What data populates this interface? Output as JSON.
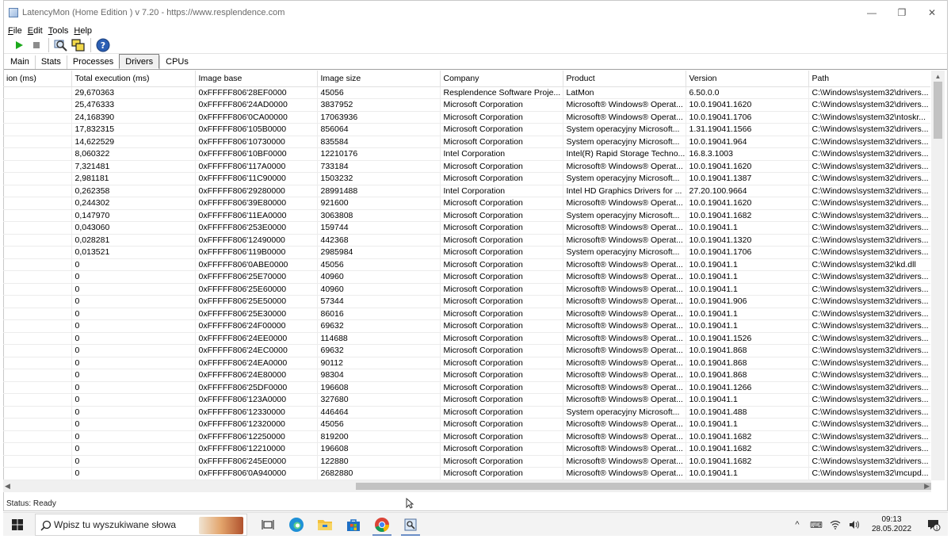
{
  "window": {
    "title": "LatencyMon  (Home Edition )  v 7.20 - https://www.resplendence.com",
    "controls": {
      "minimize": "—",
      "maximize": "❐",
      "close": "✕"
    }
  },
  "menu": [
    "File",
    "Edit",
    "Tools",
    "Help"
  ],
  "toolbar": {
    "icons": [
      "play-icon",
      "stop-icon",
      "search-icon",
      "windows-icon",
      "help-icon"
    ],
    "colors": {
      "play": "#1ca91c",
      "stop": "#8c8c8c",
      "help": "#2b5fb4"
    }
  },
  "tabs": [
    {
      "label": "Main",
      "active": false
    },
    {
      "label": "Stats",
      "active": false
    },
    {
      "label": "Processes",
      "active": false
    },
    {
      "label": "Drivers",
      "active": true
    },
    {
      "label": "CPUs",
      "active": false
    }
  ],
  "grid": {
    "columns": [
      "ion (ms)",
      "Total execution (ms)",
      "Image base",
      "Image size",
      "Company",
      "Product",
      "Version",
      "Path"
    ],
    "rows": [
      [
        "",
        "29,670363",
        "0xFFFFF806'28EF0000",
        "45056",
        "Resplendence Software Proje...",
        "LatMon",
        "6.50.0.0",
        "C:\\Windows\\system32\\drivers..."
      ],
      [
        "",
        "25,476333",
        "0xFFFFF806'24AD0000",
        "3837952",
        "Microsoft Corporation",
        "Microsoft® Windows® Operat...",
        "10.0.19041.1620",
        "C:\\Windows\\system32\\drivers..."
      ],
      [
        "",
        "24,168390",
        "0xFFFFF806'0CA00000",
        "17063936",
        "Microsoft Corporation",
        "Microsoft® Windows® Operat...",
        "10.0.19041.1706",
        "C:\\Windows\\system32\\ntoskr..."
      ],
      [
        "",
        "17,832315",
        "0xFFFFF806'105B0000",
        "856064",
        "Microsoft Corporation",
        "System operacyjny Microsoft...",
        "1.31.19041.1566",
        "C:\\Windows\\system32\\drivers..."
      ],
      [
        "",
        "14,622529",
        "0xFFFFF806'10730000",
        "835584",
        "Microsoft Corporation",
        "System operacyjny Microsoft...",
        "10.0.19041.964",
        "C:\\Windows\\system32\\drivers..."
      ],
      [
        "",
        "8,060322",
        "0xFFFFF806'10BF0000",
        "12210176",
        "Intel Corporation",
        "Intel(R) Rapid Storage Techno...",
        "16.8.3.1003",
        "C:\\Windows\\system32\\drivers..."
      ],
      [
        "",
        "7,321481",
        "0xFFFFF806'117A0000",
        "733184",
        "Microsoft Corporation",
        "Microsoft® Windows® Operat...",
        "10.0.19041.1620",
        "C:\\Windows\\system32\\drivers..."
      ],
      [
        "",
        "2,981181",
        "0xFFFFF806'11C90000",
        "1503232",
        "Microsoft Corporation",
        "System operacyjny Microsoft...",
        "10.0.19041.1387",
        "C:\\Windows\\system32\\drivers..."
      ],
      [
        "",
        "0,262358",
        "0xFFFFF806'29280000",
        "28991488",
        "Intel Corporation",
        "Intel HD Graphics Drivers for ...",
        "27.20.100.9664",
        "C:\\Windows\\system32\\drivers..."
      ],
      [
        "",
        "0,244302",
        "0xFFFFF806'39E80000",
        "921600",
        "Microsoft Corporation",
        "Microsoft® Windows® Operat...",
        "10.0.19041.1620",
        "C:\\Windows\\system32\\drivers..."
      ],
      [
        "",
        "0,147970",
        "0xFFFFF806'11EA0000",
        "3063808",
        "Microsoft Corporation",
        "System operacyjny Microsoft...",
        "10.0.19041.1682",
        "C:\\Windows\\system32\\drivers..."
      ],
      [
        "",
        "0,043060",
        "0xFFFFF806'253E0000",
        "159744",
        "Microsoft Corporation",
        "Microsoft® Windows® Operat...",
        "10.0.19041.1",
        "C:\\Windows\\system32\\drivers..."
      ],
      [
        "",
        "0,028281",
        "0xFFFFF806'12490000",
        "442368",
        "Microsoft Corporation",
        "Microsoft® Windows® Operat...",
        "10.0.19041.1320",
        "C:\\Windows\\system32\\drivers..."
      ],
      [
        "",
        "0,013521",
        "0xFFFFF806'119B0000",
        "2985984",
        "Microsoft Corporation",
        "System operacyjny Microsoft...",
        "10.0.19041.1706",
        "C:\\Windows\\system32\\drivers..."
      ],
      [
        "",
        "0",
        "0xFFFFF806'0ABE0000",
        "45056",
        "Microsoft Corporation",
        "Microsoft® Windows® Operat...",
        "10.0.19041.1",
        "C:\\Windows\\system32\\kd.dll"
      ],
      [
        "",
        "0",
        "0xFFFFF806'25E70000",
        "40960",
        "Microsoft Corporation",
        "Microsoft® Windows® Operat...",
        "10.0.19041.1",
        "C:\\Windows\\system32\\drivers..."
      ],
      [
        "",
        "0",
        "0xFFFFF806'25E60000",
        "40960",
        "Microsoft Corporation",
        "Microsoft® Windows® Operat...",
        "10.0.19041.1",
        "C:\\Windows\\system32\\drivers..."
      ],
      [
        "",
        "0",
        "0xFFFFF806'25E50000",
        "57344",
        "Microsoft Corporation",
        "Microsoft® Windows® Operat...",
        "10.0.19041.906",
        "C:\\Windows\\system32\\drivers..."
      ],
      [
        "",
        "0",
        "0xFFFFF806'25E30000",
        "86016",
        "Microsoft Corporation",
        "Microsoft® Windows® Operat...",
        "10.0.19041.1",
        "C:\\Windows\\system32\\drivers..."
      ],
      [
        "",
        "0",
        "0xFFFFF806'24F00000",
        "69632",
        "Microsoft Corporation",
        "Microsoft® Windows® Operat...",
        "10.0.19041.1",
        "C:\\Windows\\system32\\drivers..."
      ],
      [
        "",
        "0",
        "0xFFFFF806'24EE0000",
        "114688",
        "Microsoft Corporation",
        "Microsoft® Windows® Operat...",
        "10.0.19041.1526",
        "C:\\Windows\\system32\\drivers..."
      ],
      [
        "",
        "0",
        "0xFFFFF806'24EC0000",
        "69632",
        "Microsoft Corporation",
        "Microsoft® Windows® Operat...",
        "10.0.19041.868",
        "C:\\Windows\\system32\\drivers..."
      ],
      [
        "",
        "0",
        "0xFFFFF806'24EA0000",
        "90112",
        "Microsoft Corporation",
        "Microsoft® Windows® Operat...",
        "10.0.19041.868",
        "C:\\Windows\\system32\\drivers..."
      ],
      [
        "",
        "0",
        "0xFFFFF806'24E80000",
        "98304",
        "Microsoft Corporation",
        "Microsoft® Windows® Operat...",
        "10.0.19041.868",
        "C:\\Windows\\system32\\drivers..."
      ],
      [
        "",
        "0",
        "0xFFFFF806'25DF0000",
        "196608",
        "Microsoft Corporation",
        "Microsoft® Windows® Operat...",
        "10.0.19041.1266",
        "C:\\Windows\\system32\\drivers..."
      ],
      [
        "",
        "0",
        "0xFFFFF806'123A0000",
        "327680",
        "Microsoft Corporation",
        "Microsoft® Windows® Operat...",
        "10.0.19041.1",
        "C:\\Windows\\system32\\drivers..."
      ],
      [
        "",
        "0",
        "0xFFFFF806'12330000",
        "446464",
        "Microsoft Corporation",
        "System operacyjny Microsoft...",
        "10.0.19041.488",
        "C:\\Windows\\system32\\drivers..."
      ],
      [
        "",
        "0",
        "0xFFFFF806'12320000",
        "45056",
        "Microsoft Corporation",
        "Microsoft® Windows® Operat...",
        "10.0.19041.1",
        "C:\\Windows\\system32\\drivers..."
      ],
      [
        "",
        "0",
        "0xFFFFF806'12250000",
        "819200",
        "Microsoft Corporation",
        "Microsoft® Windows® Operat...",
        "10.0.19041.1682",
        "C:\\Windows\\system32\\drivers..."
      ],
      [
        "",
        "0",
        "0xFFFFF806'12210000",
        "196608",
        "Microsoft Corporation",
        "Microsoft® Windows® Operat...",
        "10.0.19041.1682",
        "C:\\Windows\\system32\\drivers..."
      ],
      [
        "",
        "0",
        "0xFFFFF806'245E0000",
        "122880",
        "Microsoft Corporation",
        "Microsoft® Windows® Operat...",
        "10.0.19041.1682",
        "C:\\Windows\\system32\\drivers..."
      ],
      [
        "",
        "0",
        "0xFFFFF806'0A940000",
        "2682880",
        "Microsoft Corporation",
        "Microsoft® Windows® Operat...",
        "10.0.19041.1",
        "C:\\Windows\\system32\\mcupd..."
      ]
    ]
  },
  "status": "Status: Ready",
  "taskbar": {
    "search_placeholder": "Wpisz tu wyszukiwane słowa",
    "apps": [
      "task-view-icon",
      "edge-icon",
      "file-explorer-icon",
      "store-icon",
      "chrome-icon",
      "latencymon-icon"
    ],
    "tray": {
      "chevron": "^",
      "keyboard": "⌨",
      "wifi": "Wi-Fi",
      "volume": "🔊"
    },
    "time": "09:13",
    "date": "28.05.2022",
    "notification_count": "1"
  }
}
